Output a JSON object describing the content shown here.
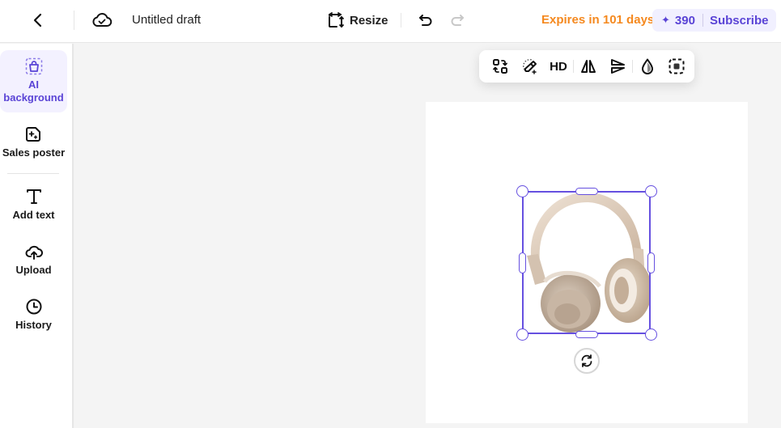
{
  "header": {
    "back_icon": "chevron-left-icon",
    "save_status_icon": "cloud-check-icon",
    "title": "Untitled draft",
    "resize_label": "Resize",
    "undo_icon": "undo-icon",
    "redo_icon": "redo-icon",
    "redo_enabled": false,
    "expires_text": "Expires in 101 days",
    "credits": "390",
    "subscribe_label": "Subscribe",
    "colors": {
      "expires": "#f5891f",
      "accent": "#5a44d6",
      "pill_bg": "#f1f0ff"
    }
  },
  "sidebar": {
    "items": [
      {
        "label_line1": "AI",
        "label_line2": "background",
        "icon": "ai-background-icon",
        "active": true
      },
      {
        "label": "Sales poster",
        "icon": "sales-poster-icon",
        "active": false
      },
      {
        "label": "Add text",
        "icon": "text-icon",
        "active": false
      },
      {
        "label": "Upload",
        "icon": "upload-cloud-icon",
        "active": false
      },
      {
        "label": "History",
        "icon": "history-clock-icon",
        "active": false
      }
    ]
  },
  "toolbar": {
    "tools": [
      {
        "name": "replace",
        "icon": "swap-icon"
      },
      {
        "name": "magic-eraser",
        "icon": "magic-eraser-icon"
      },
      {
        "name": "hd",
        "label": "HD"
      },
      {
        "name": "flip-horizontal",
        "icon": "flip-horizontal-icon"
      },
      {
        "name": "flip-vertical",
        "icon": "flip-vertical-icon"
      },
      {
        "name": "opacity",
        "icon": "opacity-drop-icon"
      },
      {
        "name": "cutout",
        "icon": "cutout-select-icon"
      }
    ]
  },
  "canvas": {
    "object": "headphones-image",
    "selected": true,
    "selection_color": "#6650e0"
  }
}
